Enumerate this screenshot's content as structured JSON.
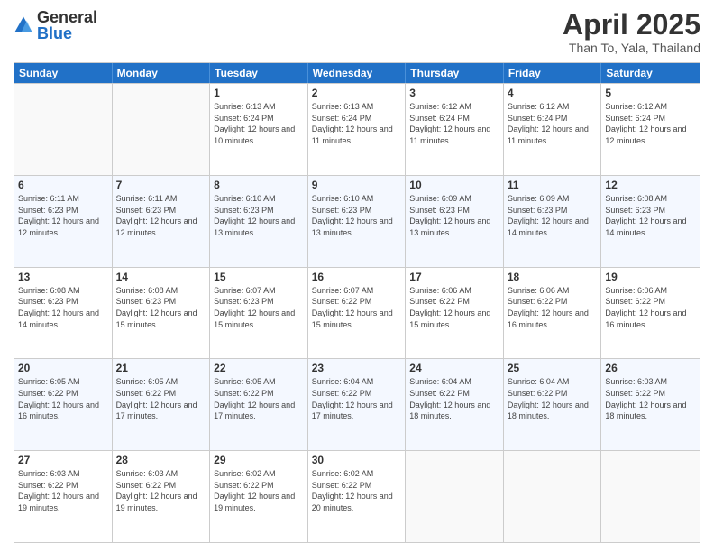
{
  "logo": {
    "general": "General",
    "blue": "Blue"
  },
  "header": {
    "title": "April 2025",
    "subtitle": "Than To, Yala, Thailand"
  },
  "days_of_week": [
    "Sunday",
    "Monday",
    "Tuesday",
    "Wednesday",
    "Thursday",
    "Friday",
    "Saturday"
  ],
  "weeks": [
    [
      {
        "day": "",
        "info": ""
      },
      {
        "day": "",
        "info": ""
      },
      {
        "day": "1",
        "info": "Sunrise: 6:13 AM\nSunset: 6:24 PM\nDaylight: 12 hours and 10 minutes."
      },
      {
        "day": "2",
        "info": "Sunrise: 6:13 AM\nSunset: 6:24 PM\nDaylight: 12 hours and 11 minutes."
      },
      {
        "day": "3",
        "info": "Sunrise: 6:12 AM\nSunset: 6:24 PM\nDaylight: 12 hours and 11 minutes."
      },
      {
        "day": "4",
        "info": "Sunrise: 6:12 AM\nSunset: 6:24 PM\nDaylight: 12 hours and 11 minutes."
      },
      {
        "day": "5",
        "info": "Sunrise: 6:12 AM\nSunset: 6:24 PM\nDaylight: 12 hours and 12 minutes."
      }
    ],
    [
      {
        "day": "6",
        "info": "Sunrise: 6:11 AM\nSunset: 6:23 PM\nDaylight: 12 hours and 12 minutes."
      },
      {
        "day": "7",
        "info": "Sunrise: 6:11 AM\nSunset: 6:23 PM\nDaylight: 12 hours and 12 minutes."
      },
      {
        "day": "8",
        "info": "Sunrise: 6:10 AM\nSunset: 6:23 PM\nDaylight: 12 hours and 13 minutes."
      },
      {
        "day": "9",
        "info": "Sunrise: 6:10 AM\nSunset: 6:23 PM\nDaylight: 12 hours and 13 minutes."
      },
      {
        "day": "10",
        "info": "Sunrise: 6:09 AM\nSunset: 6:23 PM\nDaylight: 12 hours and 13 minutes."
      },
      {
        "day": "11",
        "info": "Sunrise: 6:09 AM\nSunset: 6:23 PM\nDaylight: 12 hours and 14 minutes."
      },
      {
        "day": "12",
        "info": "Sunrise: 6:08 AM\nSunset: 6:23 PM\nDaylight: 12 hours and 14 minutes."
      }
    ],
    [
      {
        "day": "13",
        "info": "Sunrise: 6:08 AM\nSunset: 6:23 PM\nDaylight: 12 hours and 14 minutes."
      },
      {
        "day": "14",
        "info": "Sunrise: 6:08 AM\nSunset: 6:23 PM\nDaylight: 12 hours and 15 minutes."
      },
      {
        "day": "15",
        "info": "Sunrise: 6:07 AM\nSunset: 6:23 PM\nDaylight: 12 hours and 15 minutes."
      },
      {
        "day": "16",
        "info": "Sunrise: 6:07 AM\nSunset: 6:22 PM\nDaylight: 12 hours and 15 minutes."
      },
      {
        "day": "17",
        "info": "Sunrise: 6:06 AM\nSunset: 6:22 PM\nDaylight: 12 hours and 15 minutes."
      },
      {
        "day": "18",
        "info": "Sunrise: 6:06 AM\nSunset: 6:22 PM\nDaylight: 12 hours and 16 minutes."
      },
      {
        "day": "19",
        "info": "Sunrise: 6:06 AM\nSunset: 6:22 PM\nDaylight: 12 hours and 16 minutes."
      }
    ],
    [
      {
        "day": "20",
        "info": "Sunrise: 6:05 AM\nSunset: 6:22 PM\nDaylight: 12 hours and 16 minutes."
      },
      {
        "day": "21",
        "info": "Sunrise: 6:05 AM\nSunset: 6:22 PM\nDaylight: 12 hours and 17 minutes."
      },
      {
        "day": "22",
        "info": "Sunrise: 6:05 AM\nSunset: 6:22 PM\nDaylight: 12 hours and 17 minutes."
      },
      {
        "day": "23",
        "info": "Sunrise: 6:04 AM\nSunset: 6:22 PM\nDaylight: 12 hours and 17 minutes."
      },
      {
        "day": "24",
        "info": "Sunrise: 6:04 AM\nSunset: 6:22 PM\nDaylight: 12 hours and 18 minutes."
      },
      {
        "day": "25",
        "info": "Sunrise: 6:04 AM\nSunset: 6:22 PM\nDaylight: 12 hours and 18 minutes."
      },
      {
        "day": "26",
        "info": "Sunrise: 6:03 AM\nSunset: 6:22 PM\nDaylight: 12 hours and 18 minutes."
      }
    ],
    [
      {
        "day": "27",
        "info": "Sunrise: 6:03 AM\nSunset: 6:22 PM\nDaylight: 12 hours and 19 minutes."
      },
      {
        "day": "28",
        "info": "Sunrise: 6:03 AM\nSunset: 6:22 PM\nDaylight: 12 hours and 19 minutes."
      },
      {
        "day": "29",
        "info": "Sunrise: 6:02 AM\nSunset: 6:22 PM\nDaylight: 12 hours and 19 minutes."
      },
      {
        "day": "30",
        "info": "Sunrise: 6:02 AM\nSunset: 6:22 PM\nDaylight: 12 hours and 20 minutes."
      },
      {
        "day": "",
        "info": ""
      },
      {
        "day": "",
        "info": ""
      },
      {
        "day": "",
        "info": ""
      }
    ]
  ]
}
